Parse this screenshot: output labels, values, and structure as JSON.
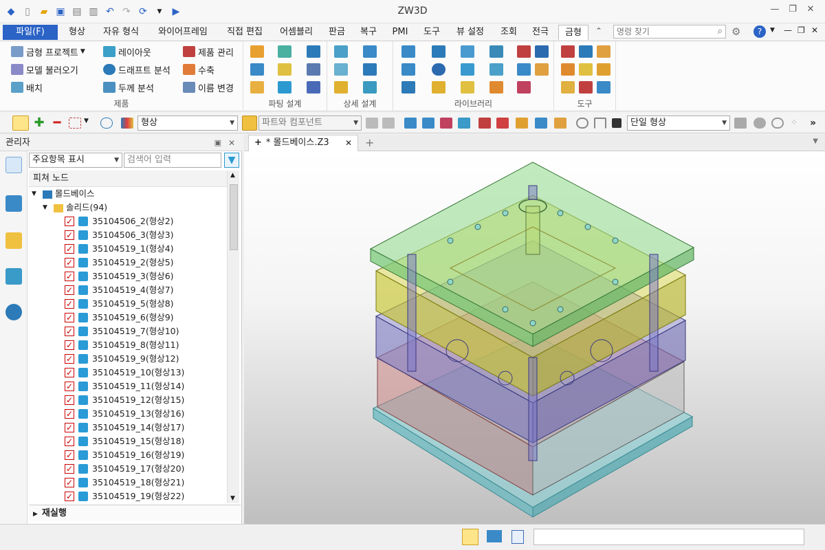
{
  "app": {
    "title": "ZW3D"
  },
  "menubar": {
    "file": "파일(F)",
    "tabs": [
      "형상",
      "자유 형식",
      "와이어프레임",
      "직접 편집",
      "어셈블리",
      "판금",
      "복구",
      "PMI",
      "도구",
      "뷰 설정",
      "조회",
      "전극",
      "금형"
    ],
    "active_tab": "금형",
    "command_search_placeholder": "명령 찾기"
  },
  "ribbon": {
    "groups": [
      {
        "label": "제품",
        "items": [
          "금형 프로젝트",
          "레이아웃",
          "제품 관리",
          "모델 불러오기",
          "드래프트 분석",
          "수축",
          "배치",
          "두께 분석",
          "이름 변경"
        ]
      },
      {
        "label": "파팅 설계"
      },
      {
        "label": "상세 설계"
      },
      {
        "label": "라이브러리"
      },
      {
        "label": "도구"
      }
    ]
  },
  "toolbar2": {
    "filter_combo": "형상",
    "part_combo": "파트와 컴포넌트",
    "shape_combo": "단일 형상"
  },
  "manager": {
    "title": "관리자",
    "display_combo": "주요항목 표시",
    "search_placeholder": "검색어 입력",
    "tree_header": "피쳐 노드",
    "root": "몰드베이스",
    "solid_group": "솔리드(94)",
    "rows": [
      "35104506_2(형상2)",
      "35104506_3(형상3)",
      "35104519_1(형상4)",
      "35104519_2(형상5)",
      "35104519_3(형상6)",
      "35104519_4(형상7)",
      "35104519_5(형상8)",
      "35104519_6(형상9)",
      "35104519_7(형상10)",
      "35104519_8(형상11)",
      "35104519_9(형상12)",
      "35104519_10(형상13)",
      "35104519_11(형상14)",
      "35104519_12(형상15)",
      "35104519_13(형상16)",
      "35104519_14(형상17)",
      "35104519_15(형상18)",
      "35104519_16(형상19)",
      "35104519_17(형상20)",
      "35104519_18(형상21)",
      "35104519_19(형상22)"
    ],
    "regen": "재실행"
  },
  "viewport": {
    "tab_label": "* 몰드베이스.Z3"
  },
  "colors": {
    "file_menu": "#2b63c6",
    "plate_top": "#8fd88a",
    "plate_cavity": "#d6d43a",
    "plate_core": "#8a86cc",
    "plate_support": "#d88a8a",
    "plate_bottom": "#7fd0d6"
  }
}
